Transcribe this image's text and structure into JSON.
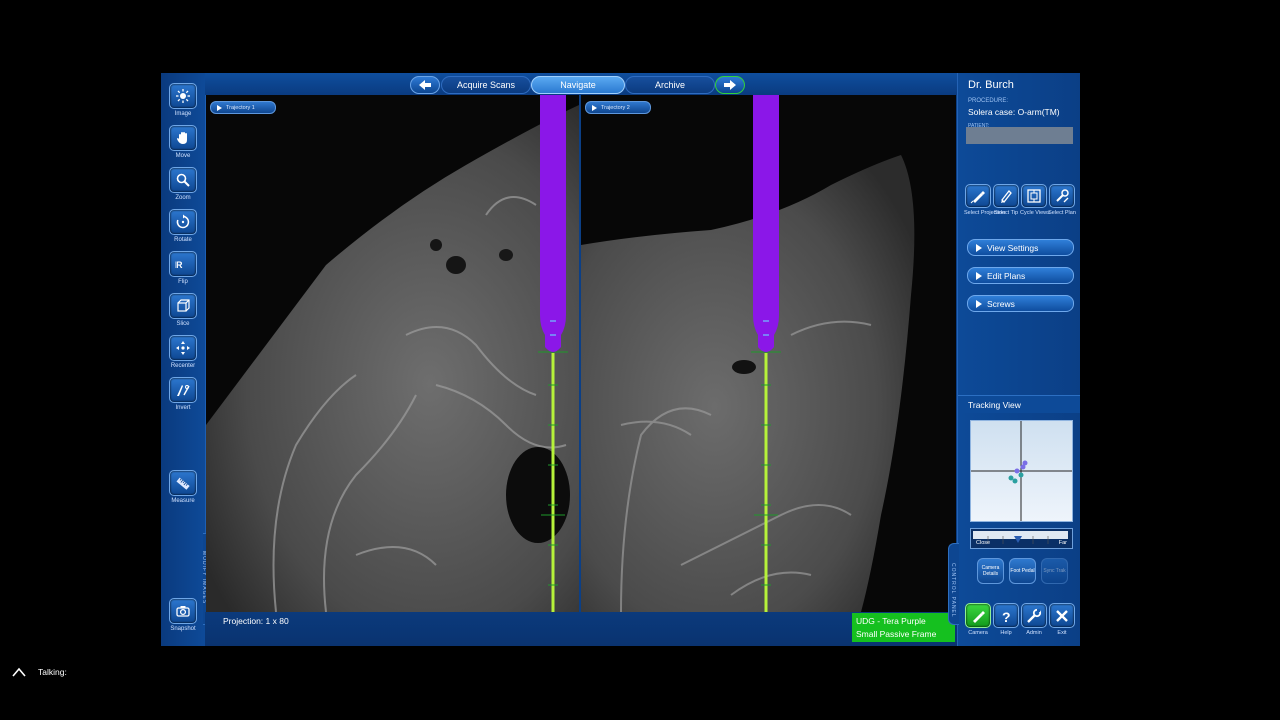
{
  "toolbar": {
    "items": [
      {
        "label": "Image",
        "icon": "sun-icon"
      },
      {
        "label": "Move",
        "icon": "hand-icon"
      },
      {
        "label": "Zoom",
        "icon": "magnifier-icon"
      },
      {
        "label": "Rotate",
        "icon": "rotate-icon"
      },
      {
        "label": "Flip",
        "icon": "flip-icon"
      },
      {
        "label": "Slice",
        "icon": "slice-icon"
      },
      {
        "label": "Recenter",
        "icon": "recenter-icon"
      },
      {
        "label": "Invert",
        "icon": "invert-icon"
      },
      {
        "label": "Measure",
        "icon": "ruler-icon"
      },
      {
        "label": "Snapshot",
        "icon": "camera-icon"
      }
    ],
    "side_label": "MODIFY IMAGES"
  },
  "nav": {
    "tabs": [
      "Acquire Scans",
      "Navigate",
      "Archive"
    ],
    "active": "Navigate"
  },
  "viewports": [
    {
      "label": "Trajectory 1"
    },
    {
      "label": "Trajectory 2"
    }
  ],
  "status": {
    "projection": "Projection: 1 x 80",
    "tracker_line1": "UDG - Tera Purple",
    "tracker_line2": "Small Passive Frame",
    "tracker_color": "#15c01f"
  },
  "panel": {
    "doctor": "Dr. Burch",
    "procedure_label": "PROCEDURE:",
    "procedure": "Solera case: O-arm(TM)",
    "patient_label": "PATIENT:",
    "tools": [
      {
        "label": "Select Projection",
        "icon": "pen-icon"
      },
      {
        "label": "Select Tip",
        "icon": "tip-icon"
      },
      {
        "label": "Cycle Views",
        "icon": "cycle-views-icon"
      },
      {
        "label": "Select Plan",
        "icon": "wrench-plan-icon"
      }
    ],
    "expanders": [
      "View Settings",
      "Edit Plans",
      "Screws"
    ],
    "tracking_title": "Tracking View",
    "distance_close": "Close",
    "distance_far": "Far",
    "small_buttons": [
      "Camera Details",
      "Foot Pedal",
      "Sync Trak"
    ],
    "bottom_tools": [
      {
        "label": "Camera",
        "icon": "camera-probe-icon"
      },
      {
        "label": "Help",
        "icon": "help-icon"
      },
      {
        "label": "Admin",
        "icon": "wrench-icon"
      },
      {
        "label": "Exit",
        "icon": "close-icon"
      }
    ],
    "side_label": "CONTROL PANEL"
  },
  "colors": {
    "instrument": "#8b17e8",
    "trajectory": "#b6f23a",
    "panel_blue": "#0b3f86"
  },
  "overlay": {
    "talking": "Talking:"
  }
}
